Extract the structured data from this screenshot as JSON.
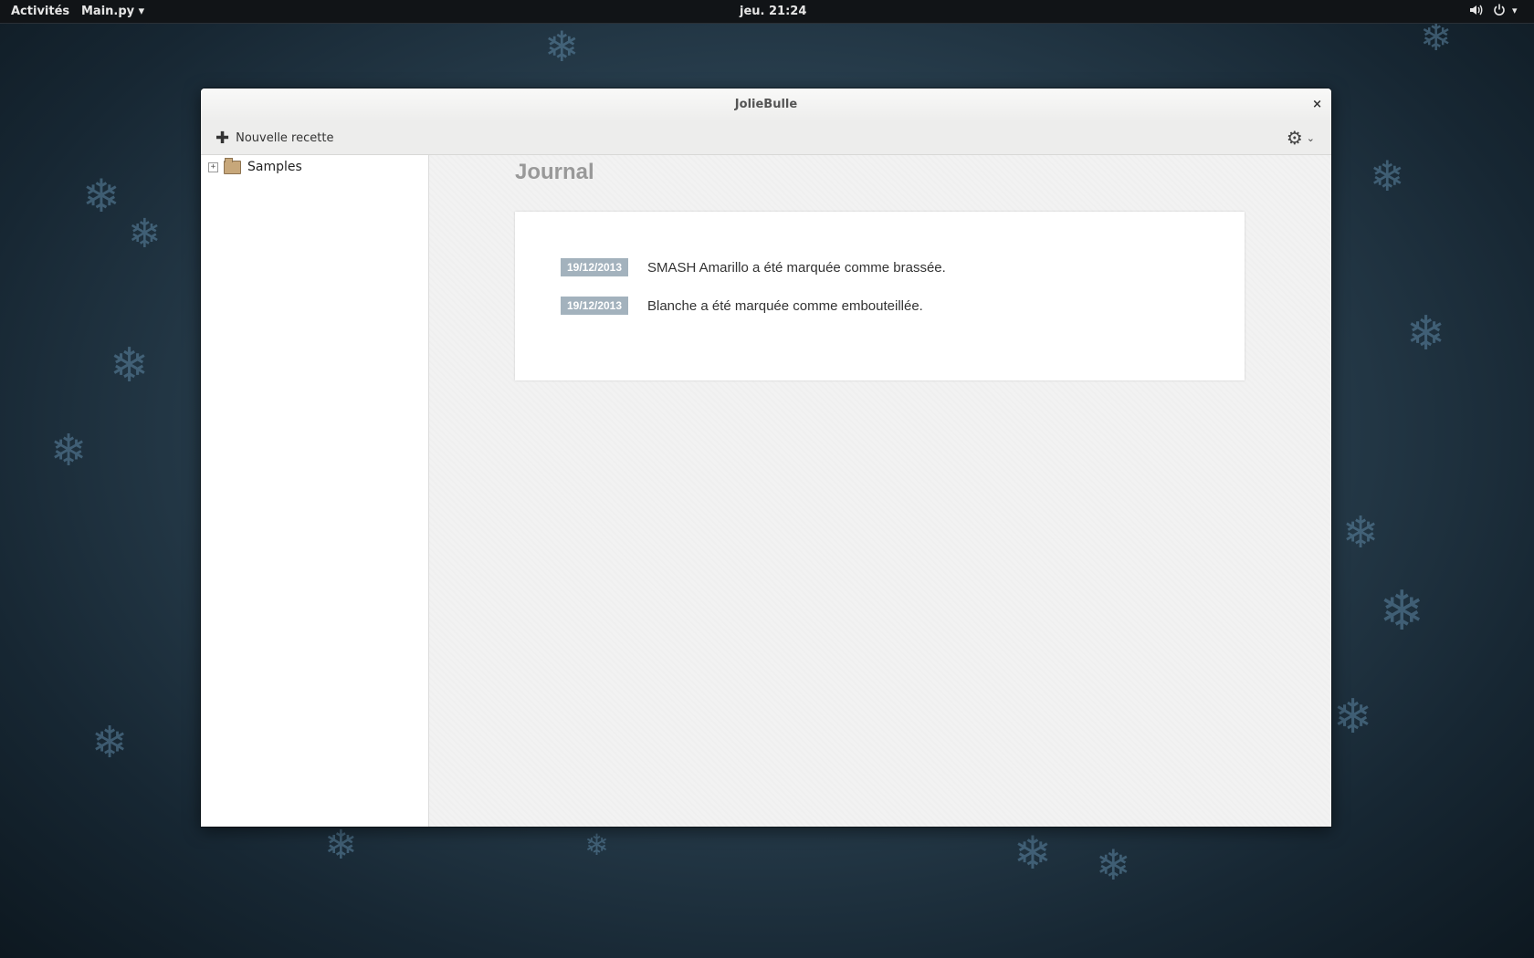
{
  "topbar": {
    "activities": "Activités",
    "app_menu": "Main.py ▾",
    "clock": "jeu. 21:24",
    "icons": [
      "volume-icon",
      "power-icon",
      "menu-arrow-icon"
    ]
  },
  "window": {
    "title": "JolieBulle",
    "close": "×"
  },
  "toolbar": {
    "new_recipe": "Nouvelle recette",
    "settings_icon": "gear-icon"
  },
  "sidebar": {
    "items": [
      {
        "label": "Samples",
        "expander": "+",
        "icon": "folder-icon"
      }
    ]
  },
  "journal": {
    "title": "Journal",
    "entries": [
      {
        "date": "19/12/2013",
        "text": "SMASH Amarillo a été marquée comme brassée."
      },
      {
        "date": "19/12/2013",
        "text": "Blanche a été marquée comme embouteillée."
      }
    ]
  },
  "colors": {
    "date_badge": "#a3b2bd",
    "journal_title": "#999999",
    "topbar": "#111417"
  }
}
